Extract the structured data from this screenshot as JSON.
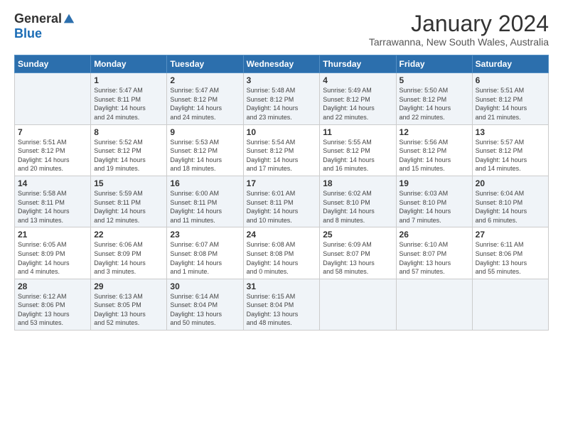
{
  "logo": {
    "general": "General",
    "blue": "Blue"
  },
  "header": {
    "month": "January 2024",
    "location": "Tarrawanna, New South Wales, Australia"
  },
  "weekdays": [
    "Sunday",
    "Monday",
    "Tuesday",
    "Wednesday",
    "Thursday",
    "Friday",
    "Saturday"
  ],
  "weeks": [
    [
      {
        "day": "",
        "info": ""
      },
      {
        "day": "1",
        "info": "Sunrise: 5:47 AM\nSunset: 8:11 PM\nDaylight: 14 hours\nand 24 minutes."
      },
      {
        "day": "2",
        "info": "Sunrise: 5:47 AM\nSunset: 8:12 PM\nDaylight: 14 hours\nand 24 minutes."
      },
      {
        "day": "3",
        "info": "Sunrise: 5:48 AM\nSunset: 8:12 PM\nDaylight: 14 hours\nand 23 minutes."
      },
      {
        "day": "4",
        "info": "Sunrise: 5:49 AM\nSunset: 8:12 PM\nDaylight: 14 hours\nand 22 minutes."
      },
      {
        "day": "5",
        "info": "Sunrise: 5:50 AM\nSunset: 8:12 PM\nDaylight: 14 hours\nand 22 minutes."
      },
      {
        "day": "6",
        "info": "Sunrise: 5:51 AM\nSunset: 8:12 PM\nDaylight: 14 hours\nand 21 minutes."
      }
    ],
    [
      {
        "day": "7",
        "info": "Sunrise: 5:51 AM\nSunset: 8:12 PM\nDaylight: 14 hours\nand 20 minutes."
      },
      {
        "day": "8",
        "info": "Sunrise: 5:52 AM\nSunset: 8:12 PM\nDaylight: 14 hours\nand 19 minutes."
      },
      {
        "day": "9",
        "info": "Sunrise: 5:53 AM\nSunset: 8:12 PM\nDaylight: 14 hours\nand 18 minutes."
      },
      {
        "day": "10",
        "info": "Sunrise: 5:54 AM\nSunset: 8:12 PM\nDaylight: 14 hours\nand 17 minutes."
      },
      {
        "day": "11",
        "info": "Sunrise: 5:55 AM\nSunset: 8:12 PM\nDaylight: 14 hours\nand 16 minutes."
      },
      {
        "day": "12",
        "info": "Sunrise: 5:56 AM\nSunset: 8:12 PM\nDaylight: 14 hours\nand 15 minutes."
      },
      {
        "day": "13",
        "info": "Sunrise: 5:57 AM\nSunset: 8:12 PM\nDaylight: 14 hours\nand 14 minutes."
      }
    ],
    [
      {
        "day": "14",
        "info": "Sunrise: 5:58 AM\nSunset: 8:11 PM\nDaylight: 14 hours\nand 13 minutes."
      },
      {
        "day": "15",
        "info": "Sunrise: 5:59 AM\nSunset: 8:11 PM\nDaylight: 14 hours\nand 12 minutes."
      },
      {
        "day": "16",
        "info": "Sunrise: 6:00 AM\nSunset: 8:11 PM\nDaylight: 14 hours\nand 11 minutes."
      },
      {
        "day": "17",
        "info": "Sunrise: 6:01 AM\nSunset: 8:11 PM\nDaylight: 14 hours\nand 10 minutes."
      },
      {
        "day": "18",
        "info": "Sunrise: 6:02 AM\nSunset: 8:10 PM\nDaylight: 14 hours\nand 8 minutes."
      },
      {
        "day": "19",
        "info": "Sunrise: 6:03 AM\nSunset: 8:10 PM\nDaylight: 14 hours\nand 7 minutes."
      },
      {
        "day": "20",
        "info": "Sunrise: 6:04 AM\nSunset: 8:10 PM\nDaylight: 14 hours\nand 6 minutes."
      }
    ],
    [
      {
        "day": "21",
        "info": "Sunrise: 6:05 AM\nSunset: 8:09 PM\nDaylight: 14 hours\nand 4 minutes."
      },
      {
        "day": "22",
        "info": "Sunrise: 6:06 AM\nSunset: 8:09 PM\nDaylight: 14 hours\nand 3 minutes."
      },
      {
        "day": "23",
        "info": "Sunrise: 6:07 AM\nSunset: 8:08 PM\nDaylight: 14 hours\nand 1 minute."
      },
      {
        "day": "24",
        "info": "Sunrise: 6:08 AM\nSunset: 8:08 PM\nDaylight: 14 hours\nand 0 minutes."
      },
      {
        "day": "25",
        "info": "Sunrise: 6:09 AM\nSunset: 8:07 PM\nDaylight: 13 hours\nand 58 minutes."
      },
      {
        "day": "26",
        "info": "Sunrise: 6:10 AM\nSunset: 8:07 PM\nDaylight: 13 hours\nand 57 minutes."
      },
      {
        "day": "27",
        "info": "Sunrise: 6:11 AM\nSunset: 8:06 PM\nDaylight: 13 hours\nand 55 minutes."
      }
    ],
    [
      {
        "day": "28",
        "info": "Sunrise: 6:12 AM\nSunset: 8:06 PM\nDaylight: 13 hours\nand 53 minutes."
      },
      {
        "day": "29",
        "info": "Sunrise: 6:13 AM\nSunset: 8:05 PM\nDaylight: 13 hours\nand 52 minutes."
      },
      {
        "day": "30",
        "info": "Sunrise: 6:14 AM\nSunset: 8:04 PM\nDaylight: 13 hours\nand 50 minutes."
      },
      {
        "day": "31",
        "info": "Sunrise: 6:15 AM\nSunset: 8:04 PM\nDaylight: 13 hours\nand 48 minutes."
      },
      {
        "day": "",
        "info": ""
      },
      {
        "day": "",
        "info": ""
      },
      {
        "day": "",
        "info": ""
      }
    ]
  ]
}
